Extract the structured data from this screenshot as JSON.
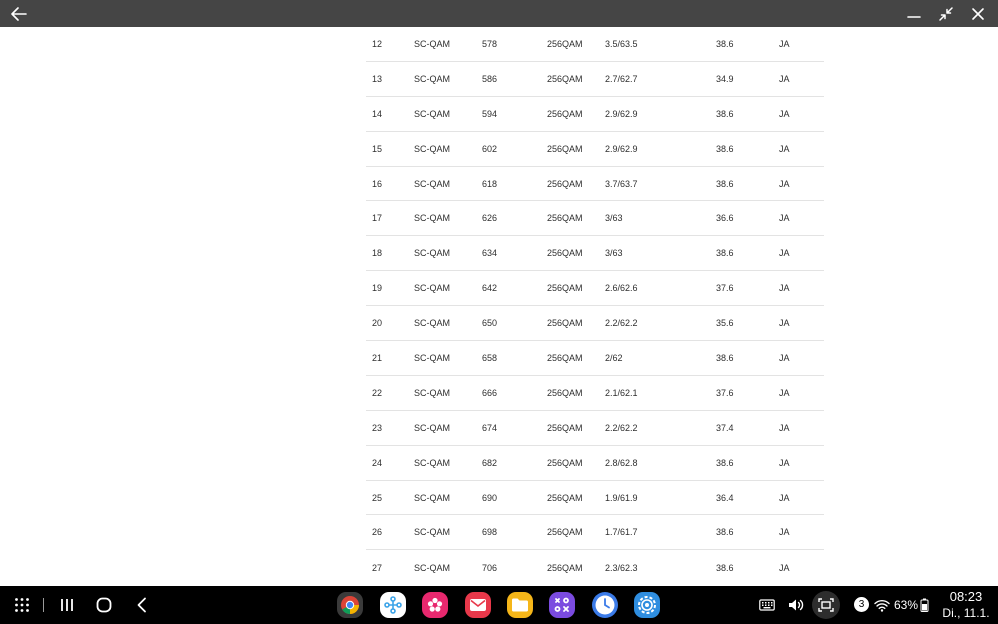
{
  "window": {
    "back_icon": "arrow-left-icon",
    "minimize_icon": "minimize-icon",
    "restore_icon": "collapse-arrows-icon",
    "close_icon": "close-icon"
  },
  "table": {
    "rows": [
      [
        "12",
        "SC-QAM",
        "578",
        "256QAM",
        "3.5/63.5",
        "38.6",
        "JA"
      ],
      [
        "13",
        "SC-QAM",
        "586",
        "256QAM",
        "2.7/62.7",
        "34.9",
        "JA"
      ],
      [
        "14",
        "SC-QAM",
        "594",
        "256QAM",
        "2.9/62.9",
        "38.6",
        "JA"
      ],
      [
        "15",
        "SC-QAM",
        "602",
        "256QAM",
        "2.9/62.9",
        "38.6",
        "JA"
      ],
      [
        "16",
        "SC-QAM",
        "618",
        "256QAM",
        "3.7/63.7",
        "38.6",
        "JA"
      ],
      [
        "17",
        "SC-QAM",
        "626",
        "256QAM",
        "3/63",
        "36.6",
        "JA"
      ],
      [
        "18",
        "SC-QAM",
        "634",
        "256QAM",
        "3/63",
        "38.6",
        "JA"
      ],
      [
        "19",
        "SC-QAM",
        "642",
        "256QAM",
        "2.6/62.6",
        "37.6",
        "JA"
      ],
      [
        "20",
        "SC-QAM",
        "650",
        "256QAM",
        "2.2/62.2",
        "35.6",
        "JA"
      ],
      [
        "21",
        "SC-QAM",
        "658",
        "256QAM",
        "2/62",
        "38.6",
        "JA"
      ],
      [
        "22",
        "SC-QAM",
        "666",
        "256QAM",
        "2.1/62.1",
        "37.6",
        "JA"
      ],
      [
        "23",
        "SC-QAM",
        "674",
        "256QAM",
        "2.2/62.2",
        "37.4",
        "JA"
      ],
      [
        "24",
        "SC-QAM",
        "682",
        "256QAM",
        "2.8/62.8",
        "38.6",
        "JA"
      ],
      [
        "25",
        "SC-QAM",
        "690",
        "256QAM",
        "1.9/61.9",
        "36.4",
        "JA"
      ],
      [
        "26",
        "SC-QAM",
        "698",
        "256QAM",
        "1.7/61.7",
        "38.6",
        "JA"
      ],
      [
        "27",
        "SC-QAM",
        "706",
        "256QAM",
        "2.3/62.3",
        "38.6",
        "JA"
      ]
    ]
  },
  "taskbar": {
    "apps": [
      {
        "name": "chrome-icon",
        "color": "#3a3a3a"
      },
      {
        "name": "bixby-routines-icon",
        "color": "#ffffff"
      },
      {
        "name": "blossom-app-icon",
        "color": "#e8286e"
      },
      {
        "name": "mail-icon",
        "color": "#e8384a"
      },
      {
        "name": "my-files-icon",
        "color": "#f5b619"
      },
      {
        "name": "galaxy-store-icon",
        "color": "#7b4be0"
      },
      {
        "name": "clock-app-icon",
        "color": "#3b7be8"
      },
      {
        "name": "settings-icon",
        "color": "#2f8ee0"
      }
    ],
    "notification_count": "3",
    "battery": "63%",
    "time": "08:23",
    "date": "Di., 11.1."
  }
}
